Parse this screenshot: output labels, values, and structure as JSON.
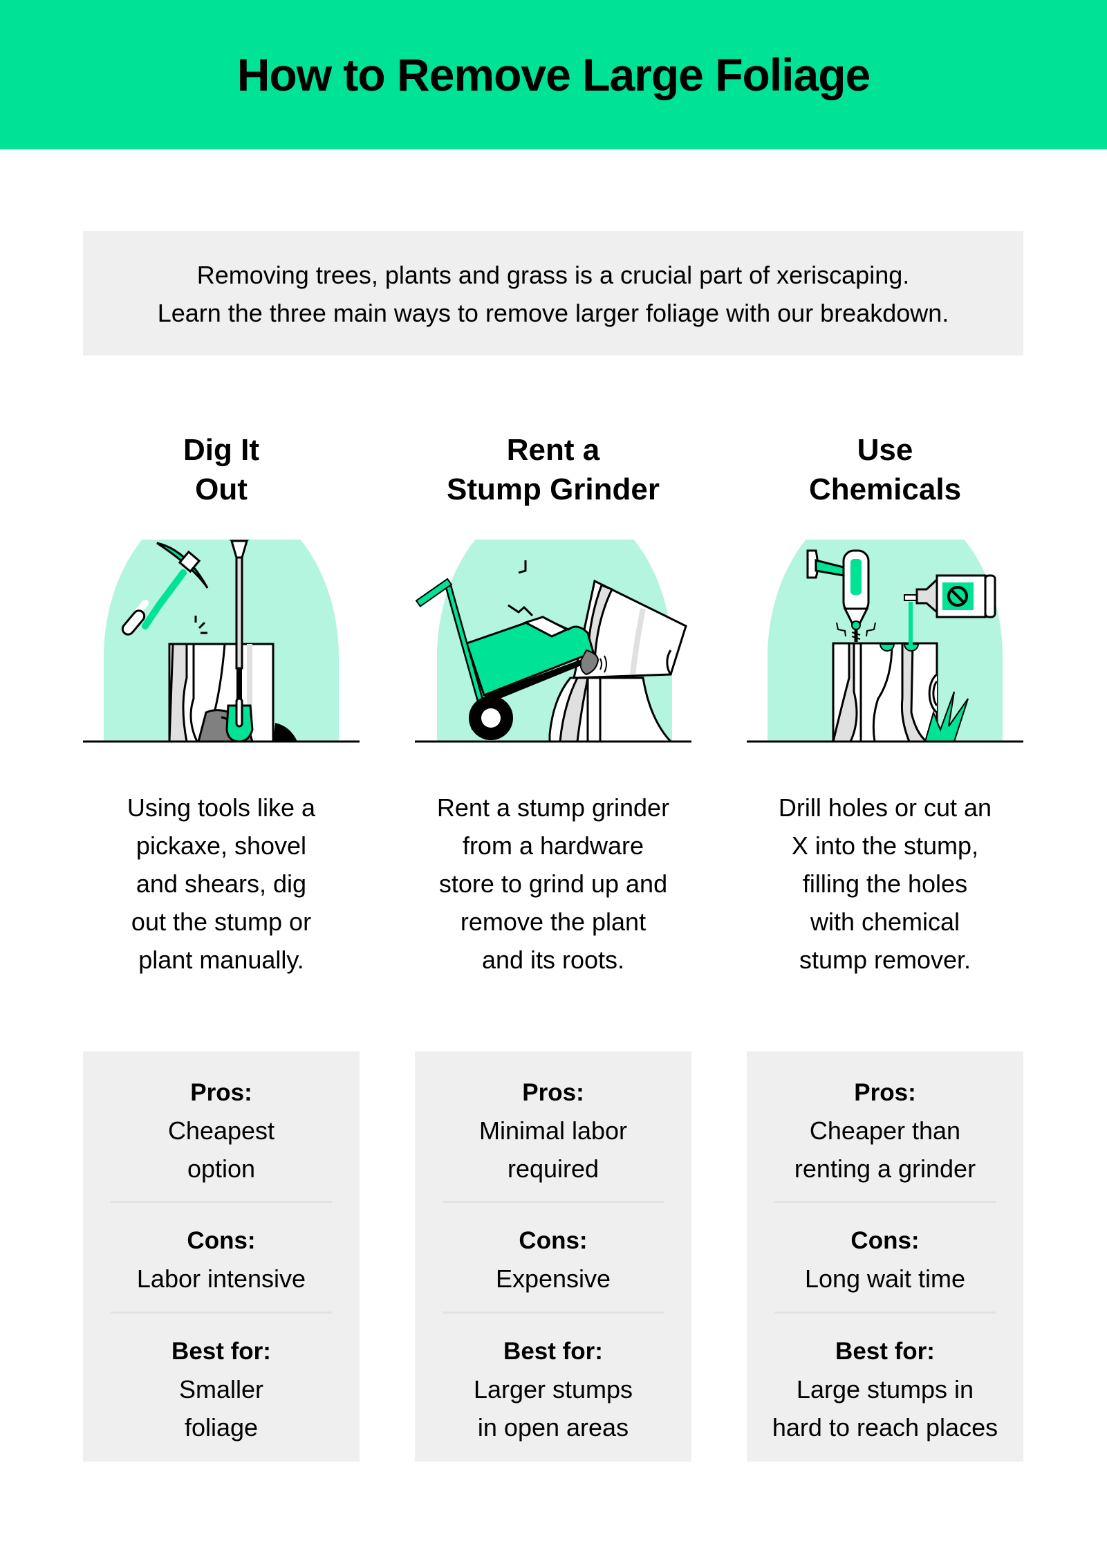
{
  "header": {
    "title": "How to Remove Large Foliage",
    "background_color": "#00e296"
  },
  "intro": {
    "lines": [
      "Removing trees, plants and grass is a crucial part of xeriscaping.",
      "Learn the three main ways to remove larger foliage with our breakdown."
    ]
  },
  "colors": {
    "accent": "#00e296",
    "arch": "#b3f5de",
    "panel": "#efefef",
    "stroke": "#000000",
    "wood_shade": "#e0e0e0",
    "rock": "#808080"
  },
  "methods": [
    {
      "heading_lines": [
        "Dig It",
        "Out"
      ],
      "illustration": "pickaxe-shovel-stump-icon",
      "description_lines": [
        "Using tools like a",
        "pickaxe, shovel",
        "and shears, dig",
        "out the stump or",
        "plant manually."
      ],
      "pros_label": "Pros:",
      "pros_lines": [
        "Cheapest",
        "option"
      ],
      "cons_label": "Cons:",
      "cons_lines": [
        "Labor intensive"
      ],
      "best_label": "Best for:",
      "best_lines": [
        "Smaller",
        "foliage"
      ]
    },
    {
      "heading_lines": [
        "Rent a",
        "Stump Grinder"
      ],
      "illustration": "stump-grinder-icon",
      "description_lines": [
        "Rent a stump grinder",
        "from a hardware",
        "store to grind up and",
        "remove the plant",
        "and its roots."
      ],
      "pros_label": "Pros:",
      "pros_lines": [
        "Minimal labor",
        "required"
      ],
      "cons_label": "Cons:",
      "cons_lines": [
        "Expensive"
      ],
      "best_label": "Best for:",
      "best_lines": [
        "Larger stumps",
        "in open areas"
      ]
    },
    {
      "heading_lines": [
        "Use",
        "Chemicals"
      ],
      "illustration": "drill-chemical-stump-icon",
      "description_lines": [
        "Drill holes or cut an",
        "X into the stump,",
        "filling the holes",
        "with chemical",
        "stump remover."
      ],
      "pros_label": "Pros:",
      "pros_lines": [
        "Cheaper than",
        "renting a grinder"
      ],
      "cons_label": "Cons:",
      "cons_lines": [
        "Long wait time"
      ],
      "best_label": "Best for:",
      "best_lines": [
        "Large stumps in",
        "hard to reach places"
      ]
    }
  ]
}
